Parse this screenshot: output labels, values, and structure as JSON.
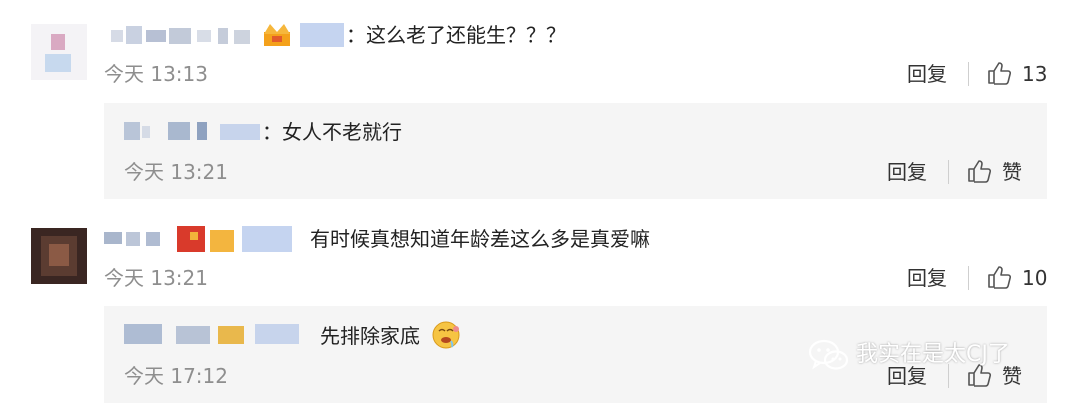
{
  "comments": [
    {
      "username": "（已模糊）",
      "text": "：这么老了还能生？？？",
      "time": "今天 13:13",
      "reply_label": "回复",
      "like_count": "13",
      "reply": {
        "username": "（已模糊）",
        "text": "：女人不老就行",
        "time": "今天 13:21",
        "reply_label": "回复",
        "like_label": "赞"
      }
    },
    {
      "username": "（已模糊）",
      "text": "有时候真想知道年龄差这么多是真爱嘛",
      "time": "今天 13:21",
      "reply_label": "回复",
      "like_count": "10",
      "reply": {
        "username": "（已模糊）",
        "text": "先排除家底",
        "time": "今天 17:12",
        "reply_label": "回复",
        "like_label": "赞"
      }
    }
  ],
  "watermark": {
    "text": "我实在是太CJ了"
  },
  "icons": {
    "like": "thumbs-up-icon",
    "crown": "crown-badge-icon",
    "emoji": "drooling-emoji-icon",
    "wechat": "wechat-logo-icon"
  },
  "colors": {
    "text": "#222222",
    "meta": "#8e8e8e",
    "reply_bg": "#f5f5f5",
    "divider": "#cfcfcf"
  }
}
